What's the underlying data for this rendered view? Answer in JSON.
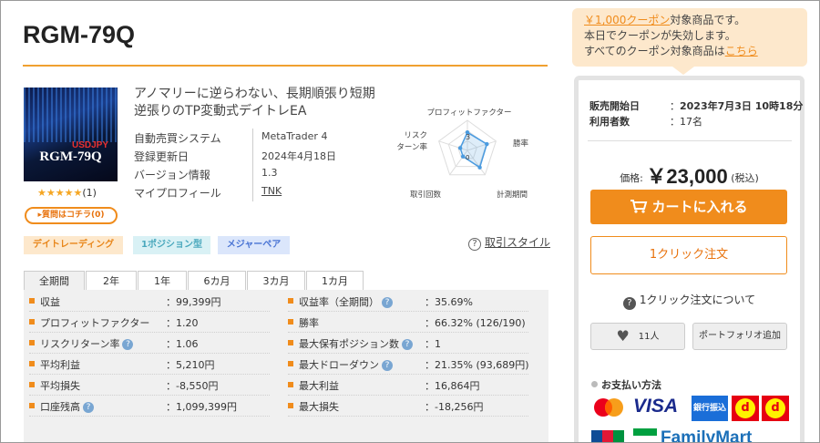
{
  "product": {
    "title": "RGM-79Q",
    "thumbnail": {
      "pair": "USDJPY",
      "name": "RGM-79Q"
    },
    "rating_stars": "★★★★★",
    "rating_count": "(1)",
    "question_button": "▸質問はコチラ(0)",
    "description": "アノマリーに逆らわない、長期順張り短期逆張りのTP変動式デイトレEA",
    "info": [
      {
        "key": "自動売買システム",
        "value": "MetaTrader 4"
      },
      {
        "key": "登録更新日",
        "value": "2024年4月18日"
      },
      {
        "key": "バージョン情報",
        "value": "1.3"
      },
      {
        "key": "マイプロフィール",
        "value": "TNK"
      }
    ],
    "radar": {
      "labels": [
        "プロフィットファクター",
        "勝率",
        "計測期間",
        "取引回数",
        "リスク",
        "ターン率"
      ],
      "scale_max": "3",
      "scale_min": "0",
      "values": [
        0.6,
        0.68,
        0.7,
        0.25,
        0.25
      ]
    },
    "tags": [
      "デイトレーディング",
      "1ポジション型",
      "メジャーペア"
    ],
    "help_link": "取引スタイル"
  },
  "stats": {
    "tabs": [
      "全期間",
      "2年",
      "1年",
      "6カ月",
      "3カ月",
      "1カ月"
    ],
    "left": [
      {
        "label": "収益",
        "help": false,
        "value": "99,399円"
      },
      {
        "label": "プロフィットファクター",
        "help": false,
        "value": "1.20"
      },
      {
        "label": "リスクリターン率",
        "help": true,
        "value": "1.06"
      },
      {
        "label": "平均利益",
        "help": false,
        "value": "5,210円"
      },
      {
        "label": "平均損失",
        "help": false,
        "value": "-8,550円"
      },
      {
        "label": "口座残高",
        "help": true,
        "value": "1,099,399円"
      }
    ],
    "right": [
      {
        "label": "収益率（全期間）",
        "help": true,
        "value": "35.69%"
      },
      {
        "label": "勝率",
        "help": false,
        "value": "66.32% (126/190)"
      },
      {
        "label": "最大保有ポジション数",
        "help": true,
        "value": "1"
      },
      {
        "label": "最大ドローダウン",
        "help": true,
        "value": "21.35% (93,689円)"
      },
      {
        "label": "最大利益",
        "help": false,
        "value": "16,864円"
      },
      {
        "label": "最大損失",
        "help": false,
        "value": "-18,256円"
      }
    ],
    "colon": "："
  },
  "coupon": {
    "highlight": "￥1,000クーポン",
    "line1_rest": "対象商品です。",
    "line2": "本日でクーポンが失効します。",
    "line3": "すべてのクーポン対象商品は",
    "line3_link": "こちら"
  },
  "purchase": {
    "sale_start_label": "販売開始日",
    "sale_start_value": "2023年7月3日 10時18分",
    "users_label": "利用者数",
    "users_value": "17名",
    "colon": "：",
    "price_label": "価格:",
    "price_value": "￥23,000",
    "tax_note": "(税込)",
    "cart_button": "カートに入れる",
    "oneclick_button": "1クリック注文",
    "about_oneclick": "1クリック注文について",
    "favorite_count": "11人",
    "portfolio_button": "ポートフォリオ追加",
    "payment_heading": "お支払い方法",
    "payments": {
      "visa": "VISA",
      "bank": "銀行振込",
      "d1": "d",
      "d2": "d",
      "familymart": "FamilyMart"
    }
  },
  "colors": {
    "accent": "#f08c1c",
    "coupon_bg": "#fde8cc",
    "help_blue": "#79a6d2",
    "radar_blue": "#4a9be0"
  }
}
